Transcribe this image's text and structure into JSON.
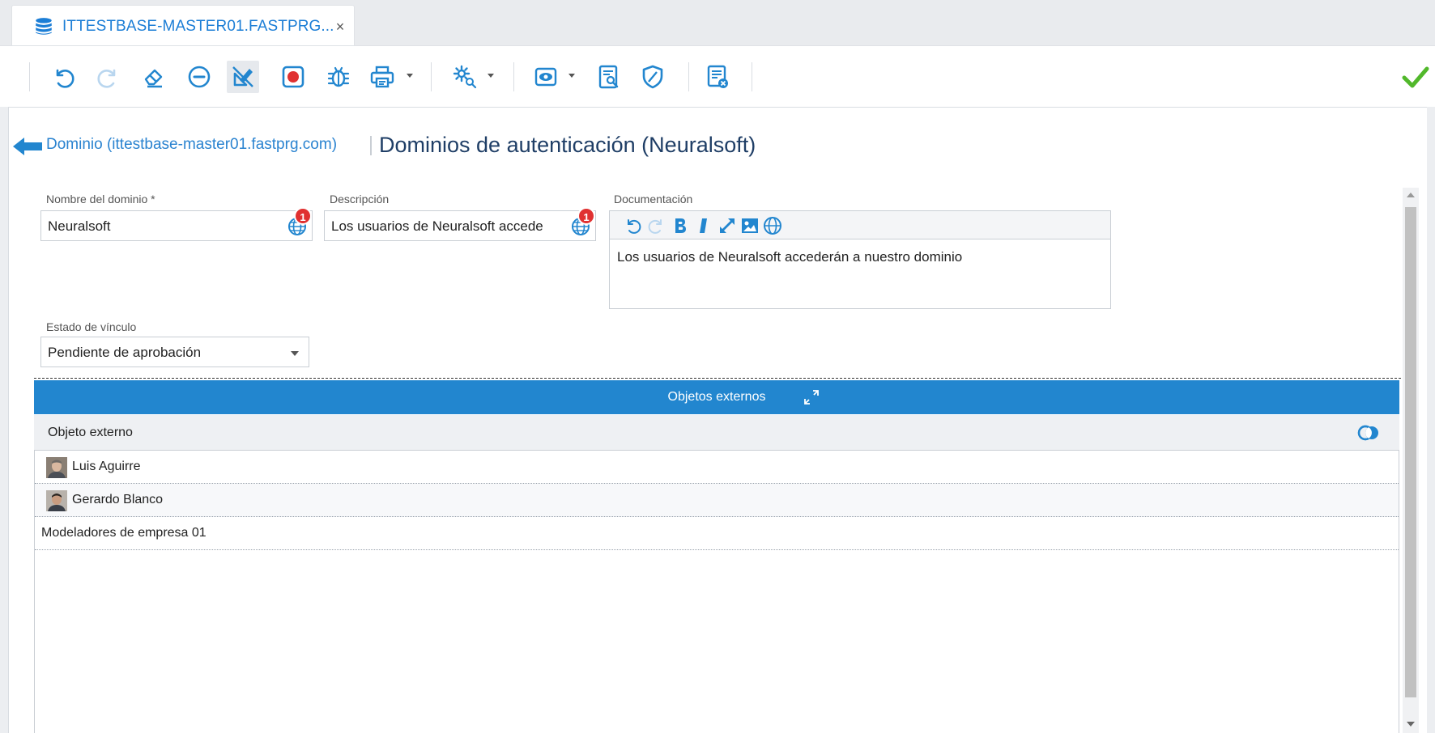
{
  "tab": {
    "title": "ITTESTBASE-MASTER01.FASTPRG...",
    "close": "×"
  },
  "toolbar": {
    "buttons": [
      "undo-icon",
      "redo-icon",
      "eraser-icon",
      "remove-icon",
      "edit-mode-icon",
      "record-icon",
      "debug-icon",
      "print-icon",
      "settings-icon",
      "view-icon",
      "preview-icon",
      "security-icon",
      "close-record-icon"
    ]
  },
  "breadcrumb": {
    "link": "Dominio (ittestbase-master01.fastprg.com)",
    "title": "Dominios de autenticación (Neuralsoft)"
  },
  "form": {
    "domain_name": {
      "label": "Nombre del dominio *",
      "value": "Neuralsoft",
      "badge": "1"
    },
    "description": {
      "label": "Descripción",
      "value": "Los usuarios de Neuralsoft accede",
      "badge": "1"
    },
    "documentation": {
      "label": "Documentación",
      "value": "Los usuarios de Neuralsoft accederán a nuestro dominio"
    },
    "link_state": {
      "label": "Estado de vínculo",
      "value": "Pendiente de aprobación"
    }
  },
  "grid": {
    "title": "Objetos externos",
    "column": "Objeto externo",
    "rows": [
      {
        "label": "Luis Aguirre",
        "avatar": true
      },
      {
        "label": "Gerardo Blanco",
        "avatar": true
      },
      {
        "label": "Modeladores de empresa 01",
        "avatar": false
      }
    ]
  },
  "colors": {
    "accent": "#2286cf",
    "link": "#2a83d0",
    "title": "#1f3e66",
    "success": "#51b82b",
    "badge": "#e03131"
  }
}
